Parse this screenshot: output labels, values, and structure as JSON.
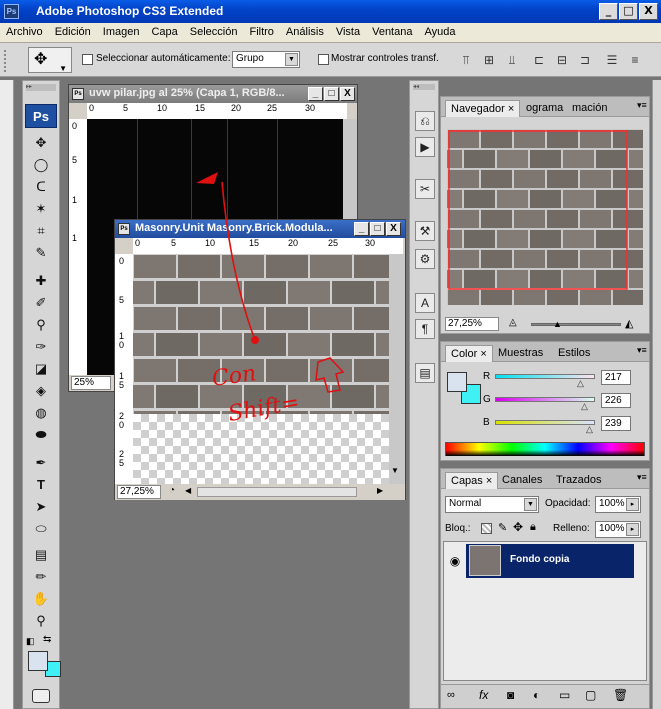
{
  "app": {
    "title": "Adobe Photoshop CS3 Extended",
    "logo": "Ps"
  },
  "window_buttons": [
    "_",
    "□",
    "X"
  ],
  "menu": [
    "Archivo",
    "Edición",
    "Imagen",
    "Capa",
    "Selección",
    "Filtro",
    "Análisis",
    "Vista",
    "Ventana",
    "Ayuda"
  ],
  "options": {
    "auto_select_label": "Seleccionar automáticamente:",
    "auto_select_value": "Grupo",
    "show_transform_label": "Mostrar controles transf."
  },
  "toolbox": {
    "logo": "Ps"
  },
  "doc1": {
    "title": "uvw pilar.jpg al 25% (Capa 1, RGB/8...",
    "zoom": "25%",
    "ruler_h": [
      "0",
      "5",
      "10",
      "15",
      "20",
      "25",
      "30"
    ],
    "ruler_v": [
      "0",
      "5",
      "1",
      "1",
      "2"
    ]
  },
  "doc2": {
    "title": "Masonry.Unit Masonry.Brick.Modula...",
    "zoom": "27,25%",
    "ruler_h": [
      "0",
      "5",
      "10",
      "15",
      "20",
      "25",
      "30"
    ],
    "ruler_v": [
      "0",
      "5",
      "1\n0",
      "1\n5",
      "2\n0",
      "2\n5"
    ]
  },
  "annotation": {
    "line1": "Con",
    "line2": "Shift="
  },
  "navigator": {
    "tabs": [
      "Navegador",
      "ograma",
      "mación"
    ],
    "zoom": "27,25%"
  },
  "color": {
    "tabs": [
      "Color",
      "Muestras",
      "Estilos"
    ],
    "r_label": "R",
    "g_label": "G",
    "b_label": "B",
    "r": "217",
    "g": "226",
    "b": "239",
    "fg": "#d9e2ef",
    "bg": "#3ff0f5"
  },
  "layers": {
    "tabs": [
      "Capas",
      "Canales",
      "Trazados"
    ],
    "blend": "Normal",
    "opacity_label": "Opacidad:",
    "opacity": "100%",
    "lock_label": "Bloq.:",
    "fill_label": "Relleno:",
    "fill": "100%",
    "layer_name": "Fondo copia"
  },
  "accent": "#0a246a",
  "annotation_color": "#e01010"
}
